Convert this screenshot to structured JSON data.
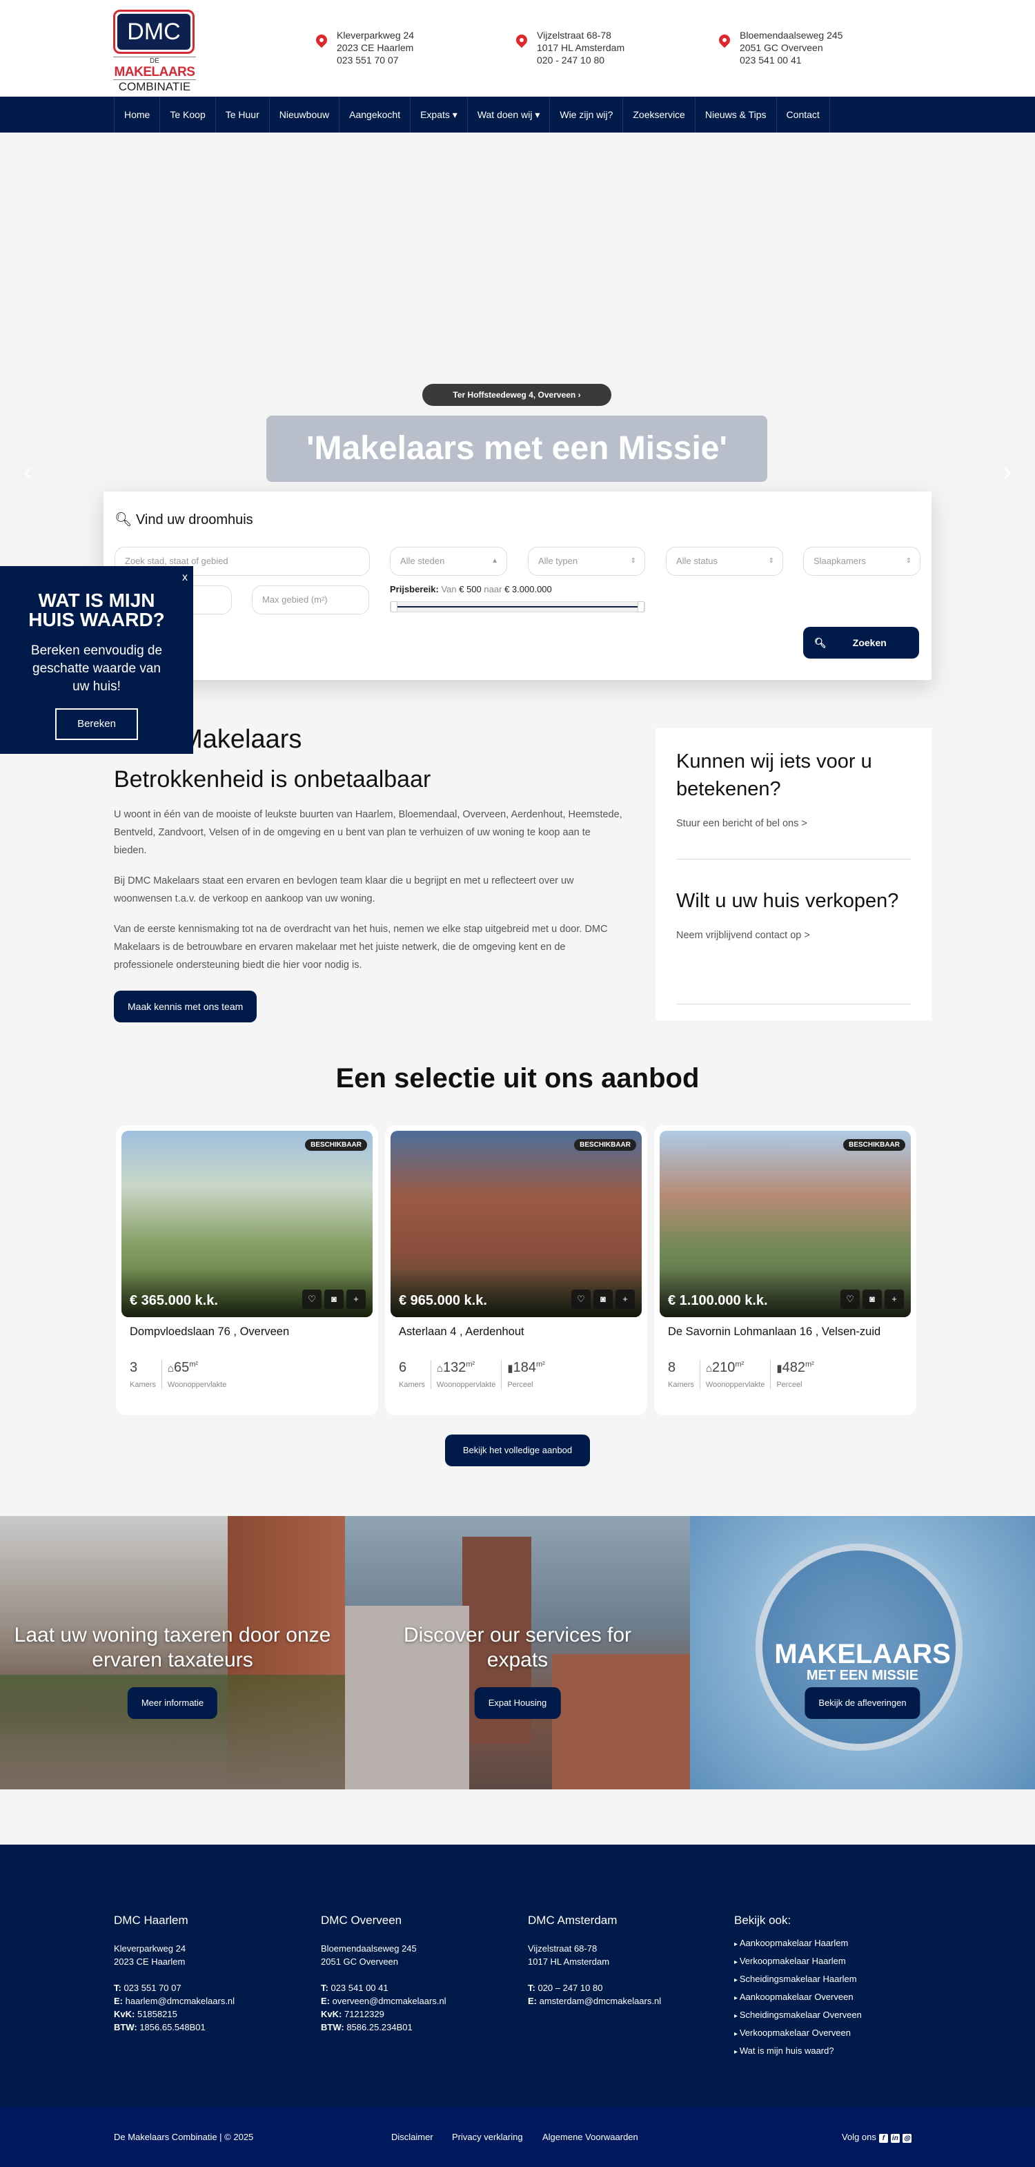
{
  "logo": {
    "top": "DMC",
    "de": "DE",
    "makelaars": "MAKELAARS",
    "combinatie": "COMBINATIE"
  },
  "offices": [
    {
      "street": "Kleverparkweg 24",
      "city": "2023 CE Haarlem",
      "phone": "023 551 70 07"
    },
    {
      "street": "Vijzelstraat 68-78",
      "city": "1017 HL Amsterdam",
      "phone": "020 - 247 10 80"
    },
    {
      "street": "Bloemendaalseweg 245",
      "city": "2051 GC Overveen",
      "phone": "023 541 00 41"
    }
  ],
  "nav": [
    "Home",
    "Te Koop",
    "Te Huur",
    "Nieuwbouw",
    "Aangekocht",
    "Expats ▾",
    "Wat doen wij ▾",
    "Wie zijn wij?",
    "Zoekservice",
    "Nieuws & Tips",
    "Contact"
  ],
  "hero": {
    "pill": "Ter Hoffsteedeweg 4, Overveen",
    "title": "'Makelaars met een Missie'"
  },
  "search": {
    "title": "Vind uw droomhuis",
    "location_placeholder": "Zoek stad, staat of gebied",
    "cities": "Alle steden",
    "types": "Alle typen",
    "status": "Alle status",
    "bedrooms": "Slaapkamers",
    "max_area_placeholder": "Max gebied (m²)",
    "price_label": "Prijsbereik:",
    "price_from_word": "Van",
    "price_from": "€ 500",
    "price_to_word": "naar",
    "price_to": "€ 3.000.000",
    "price_range_fraction": [
      0,
      1
    ],
    "submit": "Zoeken"
  },
  "popup": {
    "close": "x",
    "title": "WAT IS MIJN HUIS WAARD?",
    "text": "Bereken eenvoudig de geschatte waarde van uw huis!",
    "button": "Bereken"
  },
  "about": {
    "heading": "DMC Makelaars",
    "subheading": "Betrokkenheid is onbetaalbaar",
    "paragraphs": [
      "U woont in één van de mooiste of leukste buurten van Haarlem, Bloemendaal, Overveen, Aerdenhout, Heemstede, Bentveld, Zandvoort, Velsen of in de omgeving en u bent van plan te verhuizen of uw woning te koop aan te bieden.",
      "Bij DMC Makelaars staat een ervaren en bevlogen team klaar die u begrijpt en met u reflecteert over uw woonwensen t.a.v. de verkoop en aankoop van uw woning.",
      "Van de eerste kennismaking tot na de overdracht van het huis, nemen we elke stap uitgebreid met u door. DMC Makelaars is de betrouwbare en ervaren makelaar met het juiste netwerk, die de omgeving kent en de professionele ondersteuning biedt die hier voor nodig is."
    ],
    "button": "Maak kennis met ons team"
  },
  "side": [
    {
      "title": "Kunnen wij iets voor u betekenen?",
      "link": "Stuur een bericht of bel ons >"
    },
    {
      "title": "Wilt u uw huis verkopen?",
      "link": "Neem vrijblijvend contact op >"
    }
  ],
  "listings": {
    "title": "Een selectie uit ons aanbod",
    "labels": {
      "rooms": "Kamers",
      "living": "Woonoppervlakte",
      "plot": "Perceel",
      "unit": "m²"
    },
    "items": [
      {
        "badge": "BESCHIKBAAR",
        "price": "€ 365.000 k.k.",
        "address": "Dompvloedslaan 76 , Overveen",
        "rooms": "3",
        "living": "65",
        "plot": ""
      },
      {
        "badge": "BESCHIKBAAR",
        "price": "€ 965.000 k.k.",
        "address": "Asterlaan 4 , Aerdenhout",
        "rooms": "6",
        "living": "132",
        "plot": "184"
      },
      {
        "badge": "BESCHIKBAAR",
        "price": "€ 1.100.000 k.k.",
        "address": "De Savornin Lohmanlaan 16 , Velsen-zuid",
        "rooms": "8",
        "living": "210",
        "plot": "482"
      }
    ],
    "all_button": "Bekijk het volledige aanbod"
  },
  "banners": [
    {
      "title": "Laat uw woning taxeren door onze ervaren taxateurs",
      "button": "Meer informatie"
    },
    {
      "title": "Discover our services for expats",
      "button": "Expat Housing"
    },
    {
      "title": "",
      "button": "Bekijk de afleveringen",
      "logo_top": "MAKELAARS",
      "logo_bottom": "MET EEN MISSIE"
    }
  ],
  "footer": {
    "cols": [
      {
        "title": "DMC Haarlem",
        "l1": "Kleverparkweg 24",
        "l2": "2023 CE Haarlem",
        "t": "023 551 70 07",
        "e": "haarlem@dmcmakelaars.nl",
        "kvk": "51858215",
        "btw": "1856.65.548B01"
      },
      {
        "title": "DMC Overveen",
        "l1": "Bloemendaalseweg 245",
        "l2": "2051 GC Overveen",
        "t": "023 541 00 41",
        "e": "overveen@dmcmakelaars.nl",
        "kvk": "71212329",
        "btw": "8586.25.234B01"
      },
      {
        "title": "DMC Amsterdam",
        "l1": "Vijzelstraat 68-78",
        "l2": "1017 HL Amsterdam",
        "t": "020 – 247 10 80",
        "e": "amsterdam@dmcmakelaars.nl"
      }
    ],
    "labels": {
      "t": "T:",
      "e": "E:",
      "kvk": "KvK:",
      "btw": "BTW:"
    },
    "see_also": {
      "title": "Bekijk ook:",
      "links": [
        "Aankoopmakelaar Haarlem",
        "Verkoopmakelaar Haarlem",
        "Scheidingsmakelaar Haarlem",
        "Aankoopmakelaar Overveen",
        "Scheidingsmakelaar Overveen",
        "Verkoopmakelaar Overveen",
        "Wat is mijn huis waard?"
      ]
    },
    "copyright": "De Makelaars Combinatie | © 2025",
    "legal": [
      "Disclaimer",
      "Privacy verklaring",
      "Algemene Voorwaarden"
    ],
    "follow": "Volg ons"
  },
  "colors": {
    "navy": "#001a4a",
    "red": "#d42a36",
    "bottom_bar": "#00195e"
  }
}
